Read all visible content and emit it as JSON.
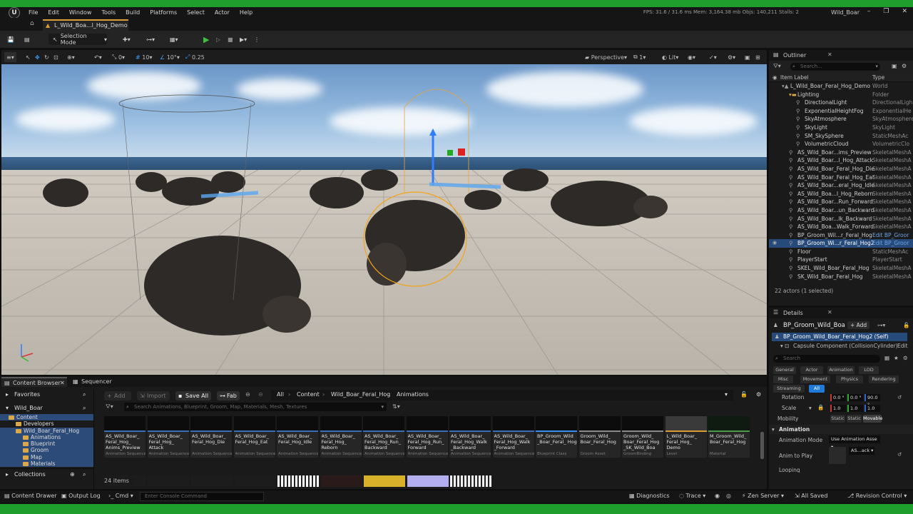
{
  "window": {
    "name": "Wild_Boar",
    "stats": "FPS: 31.6  /  31.6 ms  Mem: 3,164.38 mb  Objs: 140,211  Stalls: 2",
    "level_tab": "L_Wild_Boa...l_Hog_Demo"
  },
  "menu": [
    "File",
    "Edit",
    "Window",
    "Tools",
    "Build",
    "Platforms",
    "Select",
    "Actor",
    "Help"
  ],
  "toolbar": {
    "selection_mode": "Selection Mode"
  },
  "viewport": {
    "snap_rotate": "0",
    "grid_size": "10",
    "rotation_snap": "10°",
    "scale_snap": "0.25",
    "view_mode": "Perspective",
    "camera_speed": "1",
    "lighting_mode": "Lit"
  },
  "outliner": {
    "title": "Outliner",
    "search_placeholder": "Search...",
    "col_label": "Item Label",
    "col_type": "Type",
    "rows": [
      {
        "label": "L_Wild_Boar_Feral_Hog_Demo",
        "type": "World",
        "indent": 1
      },
      {
        "label": "Lighting",
        "type": "Folder",
        "indent": 2
      },
      {
        "label": "DirectionalLight",
        "type": "DirectionalLigh",
        "indent": 3
      },
      {
        "label": "ExponentialHeightFog",
        "type": "ExponentialHe",
        "indent": 3
      },
      {
        "label": "SkyAtmosphere",
        "type": "SkyAtmosphere",
        "indent": 3
      },
      {
        "label": "SkyLight",
        "type": "SkyLight",
        "indent": 3
      },
      {
        "label": "SM_SkySphere",
        "type": "StaticMeshAc",
        "indent": 3
      },
      {
        "label": "VolumetricCloud",
        "type": "VolumetricClo",
        "indent": 3
      },
      {
        "label": "AS_Wild_Boar...ims_Preview",
        "type": "SkeletalMeshA",
        "indent": 2
      },
      {
        "label": "AS_Wild_Boar...l_Hog_Attack",
        "type": "SkeletalMeshA",
        "indent": 2
      },
      {
        "label": "AS_Wild_Boar_Feral_Hog_Die",
        "type": "SkeletalMeshA",
        "indent": 2
      },
      {
        "label": "AS_Wild_Boar_Feral_Hog_Eat",
        "type": "SkeletalMeshA",
        "indent": 2
      },
      {
        "label": "AS_Wild_Boar...eral_Hog_Idle",
        "type": "SkeletalMeshA",
        "indent": 2
      },
      {
        "label": "AS_Wild_Boa...l_Hog_Reborn",
        "type": "SkeletalMeshA",
        "indent": 2
      },
      {
        "label": "AS_Wild_Boar...Run_Forward",
        "type": "SkeletalMeshA",
        "indent": 2
      },
      {
        "label": "AS_Wild_Boar...un_Backward",
        "type": "SkeletalMeshA",
        "indent": 2
      },
      {
        "label": "AS_Wild_Boar...lk_Backward",
        "type": "SkeletalMeshA",
        "indent": 2
      },
      {
        "label": "AS_Wild_Boa...Walk_Forward",
        "type": "SkeletalMeshA",
        "indent": 2
      },
      {
        "label": "BP_Groom_Wil...r_Feral_Hog",
        "type": "Edit BP_Groor",
        "indent": 2
      },
      {
        "label": "BP_Groom_Wi...r_Feral_Hog2",
        "type": "Edit BP_Groor",
        "indent": 2,
        "selected": true
      },
      {
        "label": "Floor",
        "type": "StaticMeshAc",
        "indent": 2
      },
      {
        "label": "PlayerStart",
        "type": "PlayerStart",
        "indent": 2
      },
      {
        "label": "SKEL_Wild_Boar_Feral_Hog",
        "type": "SkeletalMeshA",
        "indent": 2
      },
      {
        "label": "SK_Wild_Boar_Feral_Hog",
        "type": "SkeletalMeshA",
        "indent": 2
      }
    ],
    "status": "22 actors (1 selected)"
  },
  "details": {
    "title": "Details",
    "actor_name": "BP_Groom_Wild_Boa",
    "add_label": "+ Add",
    "self_row": "BP_Groom_Wild_Boar_Feral_Hog2 (Self)",
    "component_row": "Capsule Component (CollisionCylinder)",
    "component_edit": "Edit",
    "search_placeholder": "Search",
    "categories": [
      "General",
      "Actor",
      "Animation",
      "LOD",
      "Misc",
      "Movement",
      "Physics",
      "Rendering",
      "Streaming",
      "All"
    ],
    "rotation_label": "Rotation",
    "rotation_values": [
      "0.0 °",
      "0.0 °",
      "90.0 °"
    ],
    "scale_label": "Scale",
    "scale_values": [
      "1.0",
      "1.0",
      "1.0"
    ],
    "mobility_label": "Mobility",
    "mobility_options": [
      "Static",
      "Static",
      "Movable"
    ],
    "animation_section": "Animation",
    "animation_mode_label": "Animation Mode",
    "animation_mode_value": "Use Animation Asse",
    "anim_to_play_label": "Anim to Play",
    "anim_to_play_value": "AS...ack",
    "looping_label": "Looping"
  },
  "content_browser": {
    "tab": "Content Browser",
    "tab2": "Sequencer",
    "favorites": "Favorites",
    "project": "Wild_Boar",
    "collections": "Collections",
    "folders": [
      {
        "name": "Content",
        "indent": 0
      },
      {
        "name": "Developers",
        "indent": 1
      },
      {
        "name": "Wild_Boar_Feral_Hog",
        "indent": 1
      },
      {
        "name": "Animations",
        "indent": 2
      },
      {
        "name": "Blueprint",
        "indent": 2
      },
      {
        "name": "Groom",
        "indent": 2
      },
      {
        "name": "Map",
        "indent": 2
      },
      {
        "name": "Materials",
        "indent": 2
      }
    ],
    "add": "Add",
    "import": "Import",
    "save_all": "Save All",
    "fab": "Fab",
    "breadcrumb": [
      "All",
      "Content",
      "Wild_Boar_Feral_Hog",
      "Animations"
    ],
    "search_placeholder": "Search Animations, Blueprint, Groom, Map, Materials, Mesh, Textures",
    "assets": [
      {
        "name": "AS_Wild_Boar_ Feral_Hog_ Anims_Preview",
        "kind": "Animation Sequence"
      },
      {
        "name": "AS_Wild_Boar_ Feral_Hog_ Attack",
        "kind": "Animation Sequence"
      },
      {
        "name": "AS_Wild_Boar_ Feral_Hog_Die",
        "kind": "Animation Sequence"
      },
      {
        "name": "AS_Wild_Boar_ Feral_Hog_Eat",
        "kind": "Animation Sequence"
      },
      {
        "name": "AS_Wild_Boar_ Feral_Hog_Idle",
        "kind": "Animation Sequence"
      },
      {
        "name": "AS_Wild_Boar_ Feral_Hog_ Reborn",
        "kind": "Animation Sequence"
      },
      {
        "name": "AS_Wild_Boar_ Feral_Hog_Run_ Backward",
        "kind": "Animation Sequence"
      },
      {
        "name": "AS_Wild_Boar_ Feral_Hog_Run_ Forward",
        "kind": "Animation Sequence"
      },
      {
        "name": "AS_Wild_Boar_ Feral_Hog_Walk _Backward",
        "kind": "Animation Sequence"
      },
      {
        "name": "AS_Wild_Boar_ Feral_Hog_Walk _Forward",
        "kind": "Animation Sequence"
      },
      {
        "name": "BP_Groom_Wild _Boar_Feral_ Hog",
        "kind": "Blueprint Class"
      },
      {
        "name": "Groom_Wild_ Boar_Feral_Hog",
        "kind": "Groom Asset"
      },
      {
        "name": "Groom_Wild_ Boar_Feral_Hog _SK_Wild_Boa",
        "kind": "GroomBinding"
      },
      {
        "name": "L_Wild_Boar_ Feral_Hog_ Demo",
        "kind": "Level"
      },
      {
        "name": "M_Groom_Wild_ Boar_Feral_Hog",
        "kind": "Material"
      }
    ],
    "item_count": "24 items"
  },
  "statusbar": {
    "content_drawer": "Content Drawer",
    "output_log": "Output Log",
    "cmd": "Cmd",
    "console_placeholder": "Enter Console Command",
    "diagnostics": "Diagnostics",
    "trace": "Trace",
    "zen_server": "Zen Server",
    "all_saved": "All Saved",
    "revision_control": "Revision Control"
  },
  "colors": {
    "accent_blue": "#1f7ad8",
    "selection": "#264a7a",
    "play_green": "#3fc13f",
    "folder": "#d9a84a"
  }
}
